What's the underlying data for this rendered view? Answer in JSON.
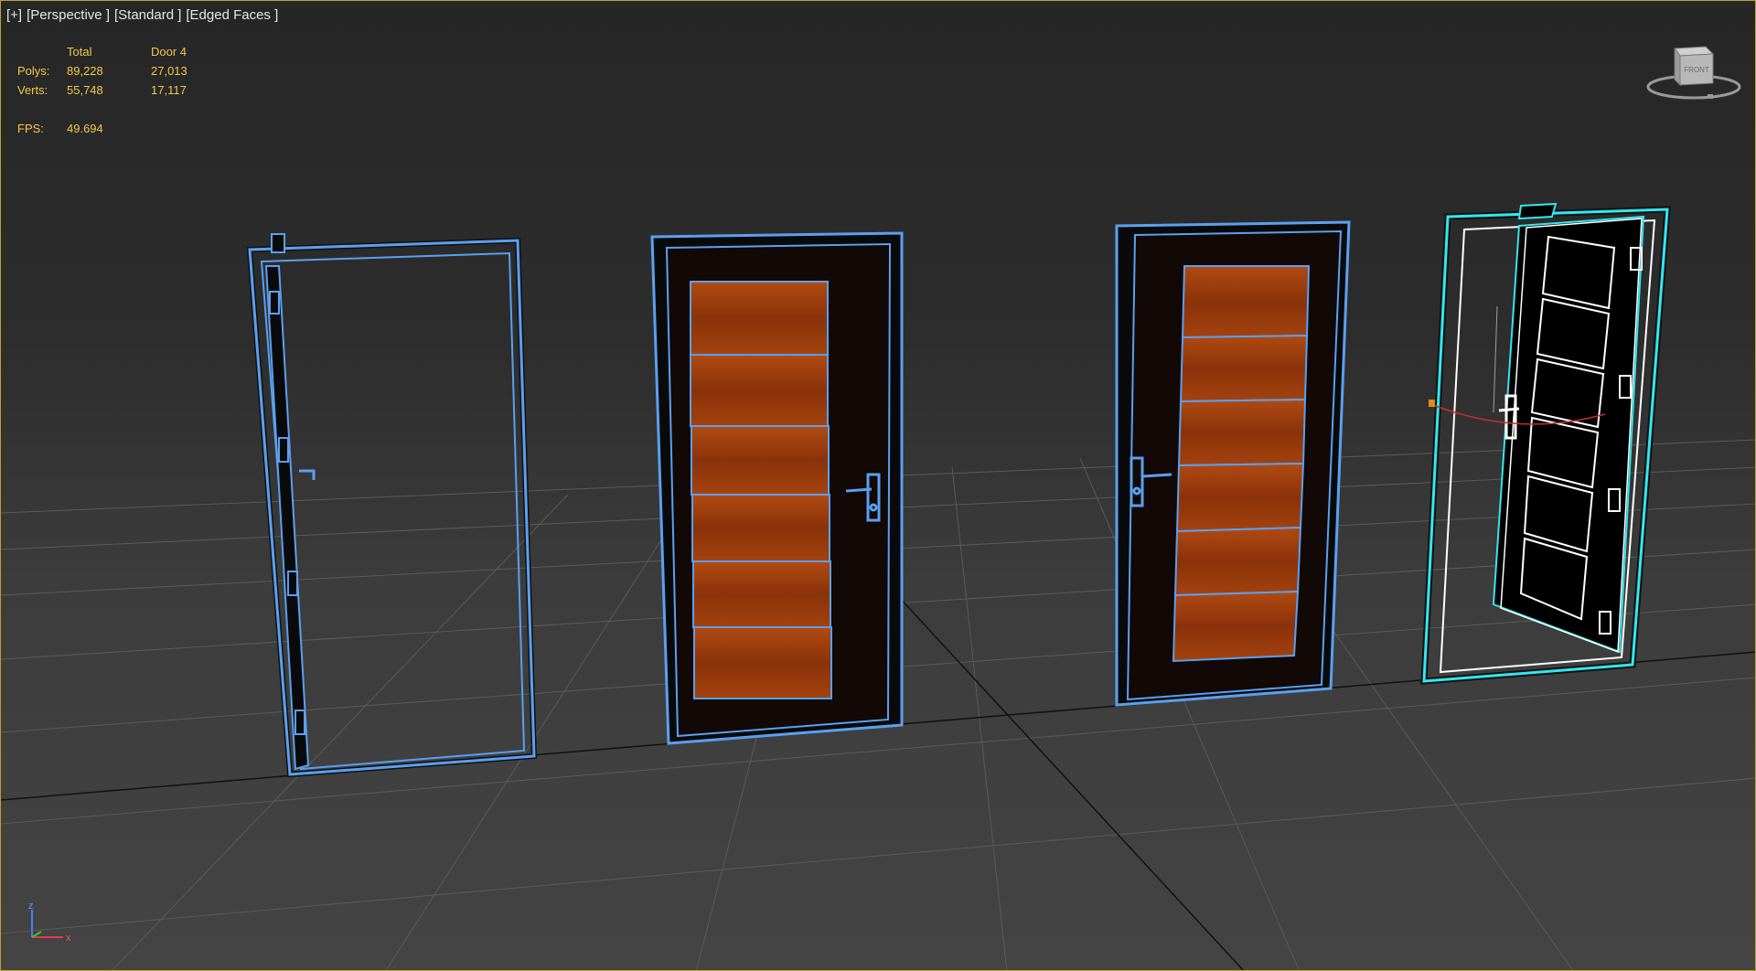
{
  "viewport": {
    "labels": {
      "plus": "[+]",
      "view": "[Perspective ]",
      "shading": "[Standard ]",
      "mode": "[Edged Faces ]"
    }
  },
  "stats": {
    "col_total": "Total",
    "col_selected": "Door 4",
    "polys_label": "Polys:",
    "polys_total": "89,228",
    "polys_selected": "27,013",
    "verts_label": "Verts:",
    "verts_total": "55,748",
    "verts_selected": "17,117",
    "fps_label": "FPS:",
    "fps_value": "49.694"
  },
  "viewcube": {
    "face_label": "FRONT"
  },
  "axis": {
    "z": "z",
    "x": "x"
  },
  "colors": {
    "wireframe": "#5aa0f0",
    "selected": "#33e6f0",
    "wood": "#a0400c",
    "stats_text": "#f2c94c",
    "viewport_border": "#b8a23a"
  }
}
